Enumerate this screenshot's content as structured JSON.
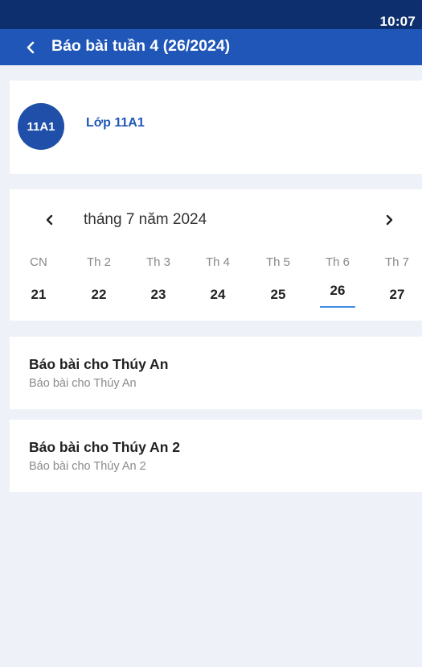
{
  "status_bar": {
    "time": "10:07"
  },
  "app_bar": {
    "title": "Báo bài tuần 4 (26/2024)"
  },
  "class_info": {
    "avatar_text": "11A1",
    "name": "Lớp 11A1"
  },
  "calendar": {
    "month_label": "tháng 7 năm 2024",
    "weekdays": [
      "CN",
      "Th 2",
      "Th 3",
      "Th 4",
      "Th 5",
      "Th 6",
      "Th 7"
    ],
    "days": [
      "21",
      "22",
      "23",
      "24",
      "25",
      "26",
      "27"
    ],
    "selected_day": "26"
  },
  "reports": [
    {
      "title": "Báo bài cho Thúy An",
      "subtitle": "Báo bài cho Thúy An"
    },
    {
      "title": "Báo bài cho Thúy An 2",
      "subtitle": "Báo bài cho Thúy An 2"
    }
  ],
  "colors": {
    "status_bar": "#0d2f6e",
    "app_bar": "#1f56b7",
    "avatar": "#1f4fa8",
    "selected_underline": "#3f8ee6",
    "background": "#eef2f8"
  }
}
